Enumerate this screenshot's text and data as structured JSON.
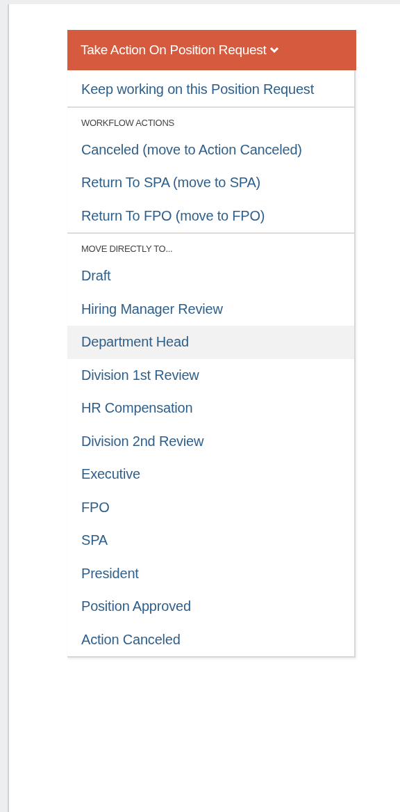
{
  "action_button": {
    "label": "Take Action On Position Request",
    "expanded": true
  },
  "menu_sections": [
    {
      "items": [
        {
          "label": "Keep working on this Position Request",
          "highlighted": false
        }
      ]
    },
    {
      "header": "WORKFLOW ACTIONS",
      "items": [
        {
          "label": "Canceled (move to Action Canceled)",
          "highlighted": false
        },
        {
          "label": "Return To SPA (move to SPA)",
          "highlighted": false
        },
        {
          "label": "Return To FPO (move to FPO)",
          "highlighted": false
        }
      ]
    },
    {
      "header": "MOVE DIRECTLY TO...",
      "items": [
        {
          "label": "Draft",
          "highlighted": false
        },
        {
          "label": "Hiring Manager Review",
          "highlighted": false
        },
        {
          "label": "Department Head",
          "highlighted": true
        },
        {
          "label": "Division 1st Review",
          "highlighted": false
        },
        {
          "label": "HR Compensation",
          "highlighted": false
        },
        {
          "label": "Division 2nd Review",
          "highlighted": false
        },
        {
          "label": "Executive",
          "highlighted": false
        },
        {
          "label": "FPO",
          "highlighted": false
        },
        {
          "label": "SPA",
          "highlighted": false
        },
        {
          "label": "President",
          "highlighted": false
        },
        {
          "label": "Position Approved",
          "highlighted": false
        },
        {
          "label": "Action Canceled",
          "highlighted": false
        }
      ]
    }
  ]
}
